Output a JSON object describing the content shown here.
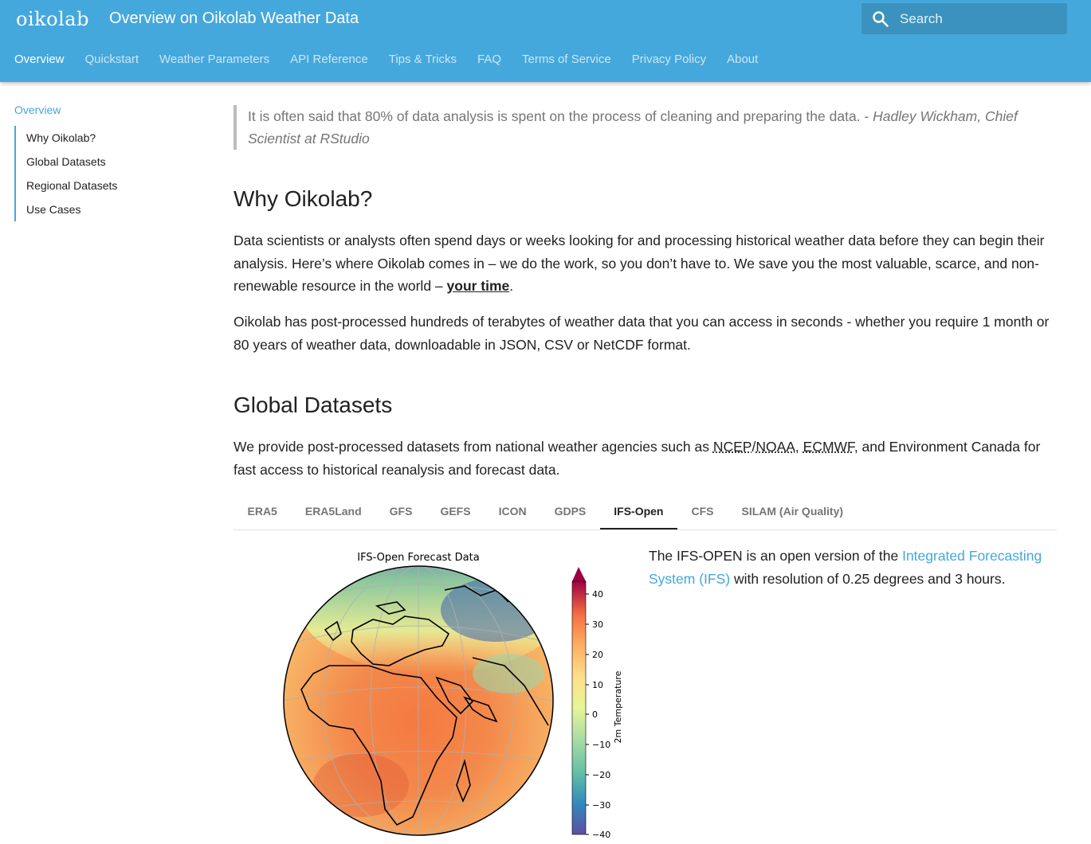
{
  "header": {
    "logo": "oikolab",
    "title": "Overview on Oikolab Weather Data",
    "search_placeholder": "Search",
    "search_icon": "search-icon"
  },
  "nav": {
    "tabs": [
      "Overview",
      "Quickstart",
      "Weather Parameters",
      "API Reference",
      "Tips & Tricks",
      "FAQ",
      "Terms of Service",
      "Privacy Policy",
      "About"
    ],
    "active": "Overview"
  },
  "sidebar": {
    "top": "Overview",
    "items": [
      "Why Oikolab?",
      "Global Datasets",
      "Regional Datasets",
      "Use Cases"
    ]
  },
  "quote": {
    "text": "It is often said that 80% of data analysis is spent on the process of cleaning and preparing the data. - ",
    "author": "Hadley Wickham, Chief Scientist at RStudio"
  },
  "why": {
    "heading": "Why Oikolab?",
    "p1_before": "Data scientists or analysts often spend days or weeks looking for and processing historical weather data before they can begin their analysis. Here’s where Oikolab comes in – we do the work, so you don’t have to. We save you the most valuable, scarce, and non-renewable resource in the world – ",
    "p1_link": "your time",
    "p1_after": ".",
    "p2": "Oikolab has post-processed hundreds of terabytes of weather data that you can access in seconds - whether you require 1 month or 80 years of weather data, downloadable in JSON, CSV or NetCDF format."
  },
  "global": {
    "heading": "Global Datasets",
    "p_before": "We provide post-processed datasets from national weather agencies such as ",
    "abbr1": "NCEP",
    "slash": "/",
    "abbr2": "NOAA",
    "comma": ", ",
    "abbr3": "ECMWF",
    "p_after": ", and Environment Canada for fast access to historical reanalysis and forecast data."
  },
  "dataset_tabs": {
    "items": [
      "ERA5",
      "ERA5Land",
      "GFS",
      "GEFS",
      "ICON",
      "GDPS",
      "IFS-Open",
      "CFS",
      "SILAM (Air Quality)"
    ],
    "active": "IFS-Open"
  },
  "ifs": {
    "before": "The IFS-OPEN is an open version of the ",
    "link": "Integrated Forecasting System (IFS)",
    "after": " with resolution of 0.25 degrees and 3 hours."
  },
  "figure": {
    "title": "IFS-Open Forecast Data",
    "colorbar_label": "2m Temperature",
    "ticks": [
      "40",
      "30",
      "20",
      "10",
      "0",
      "−10",
      "−20",
      "−30",
      "−40"
    ]
  }
}
